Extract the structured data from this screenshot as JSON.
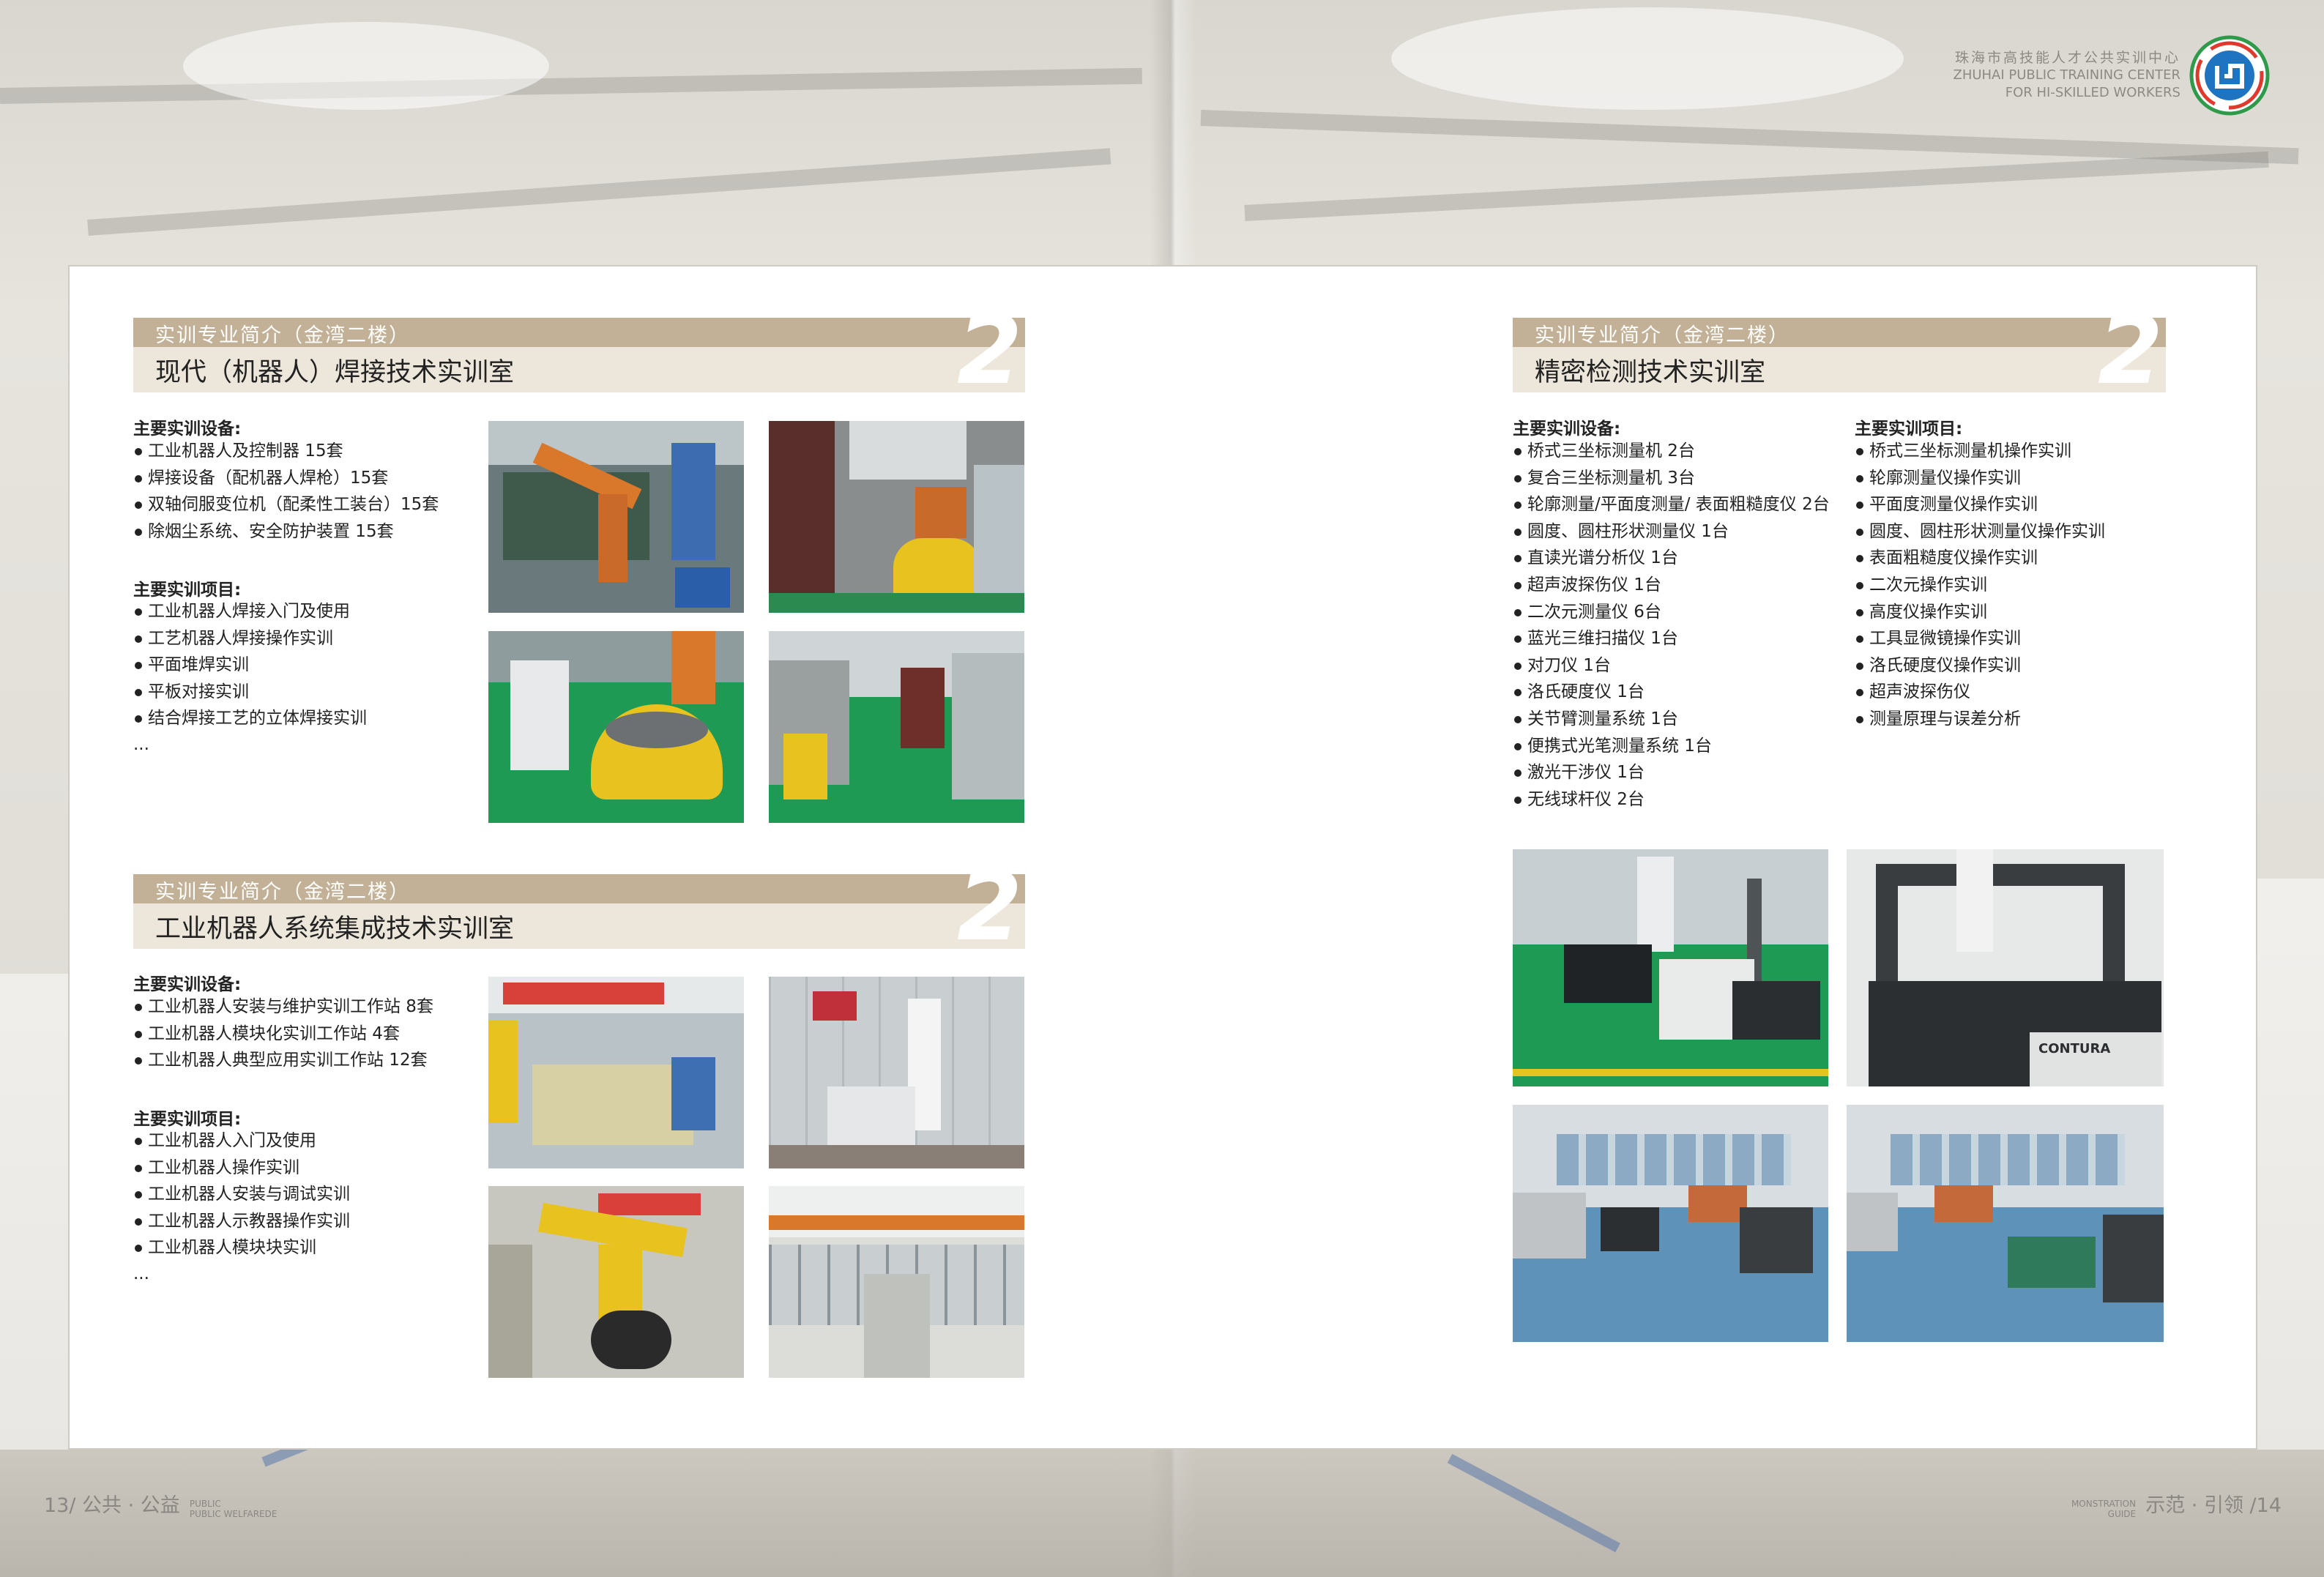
{
  "header": {
    "org_cn": "珠海市高技能人才公共实训中心",
    "org_en_1": "ZHUHAI PUBLIC TRAINING CENTER",
    "org_en_2": "FOR HI-SKILLED WORKERS"
  },
  "sections": [
    {
      "subtitle": "实训专业简介（金湾二楼）",
      "title": "现代（机器人）焊接技术实训室",
      "number": "2",
      "equipment_head": "主要实训设备:",
      "equipment": [
        "工业机器人及控制器 15套",
        "焊接设备（配机器人焊枪）15套",
        "双轴伺服变位机（配柔性工装台）15套",
        "除烟尘系统、安全防护装置 15套"
      ],
      "projects_head": "主要实训项目:",
      "projects": [
        "工业机器人焊接入门及使用",
        "工艺机器人焊接操作实训",
        "平面堆焊实训",
        "平板对接实训",
        "结合焊接工艺的立体焊接实训"
      ],
      "ellipsis": "..."
    },
    {
      "subtitle": "实训专业简介（金湾二楼）",
      "title": "工业机器人系统集成技术实训室",
      "number": "2",
      "equipment_head": "主要实训设备:",
      "equipment": [
        "工业机器人安装与维护实训工作站 8套",
        "工业机器人模块化实训工作站 4套",
        "工业机器人典型应用实训工作站 12套"
      ],
      "projects_head": "主要实训项目:",
      "projects": [
        "工业机器人入门及使用",
        "工业机器人操作实训",
        "工业机器人安装与调试实训",
        "工业机器人示教器操作实训",
        "工业机器人模块块实训"
      ],
      "ellipsis": "..."
    },
    {
      "subtitle": "实训专业简介（金湾二楼）",
      "title": "精密检测技术实训室",
      "number": "2",
      "equipment_head": "主要实训设备:",
      "equipment": [
        "桥式三坐标测量机 2台",
        "复合三坐标测量机 3台",
        "轮廓测量/平面度测量/ 表面粗糙度仪 2台",
        "圆度、圆柱形状测量仪 1台",
        "直读光谱分析仪 1台",
        "超声波探伤仪 1台",
        "二次元测量仪 6台",
        "蓝光三维扫描仪 1台",
        "对刀仪 1台",
        "洛氏硬度仪 1台",
        "关节臂测量系统 1台",
        "便携式光笔测量系统 1台",
        "激光干涉仪 1台",
        "无线球杆仪 2台"
      ],
      "projects_head": "主要实训项目:",
      "projects": [
        "桥式三坐标测量机操作实训",
        "轮廓测量仪操作实训",
        "平面度测量仪操作实训",
        "圆度、圆柱形状测量仪操作实训",
        "表面粗糙度仪操作实训",
        "二次元操作实训",
        "高度仪操作实训",
        "工具显微镜操作实训",
        "洛氏硬度仪操作实训",
        "超声波探伤仪",
        "测量原理与误差分析"
      ]
    }
  ],
  "photo_labels": {
    "contura": "CONTURA"
  },
  "footer": {
    "left_page": "13/ 公共 · 公益",
    "left_small_1": "PUBLIC",
    "left_small_2": "PUBLIC WELFAREDE",
    "right_page": "示范 · 引领 /14",
    "right_small_1": "MONSTRATION",
    "right_small_2": "GUIDE"
  },
  "colors": {
    "banner_top": "#c2b196",
    "banner_bottom": "#ece7da",
    "floor_green": "#1f9a55",
    "robot_orange": "#d9772a",
    "robot_yellow": "#e8c21f",
    "floor_blue": "#5f92b8"
  }
}
